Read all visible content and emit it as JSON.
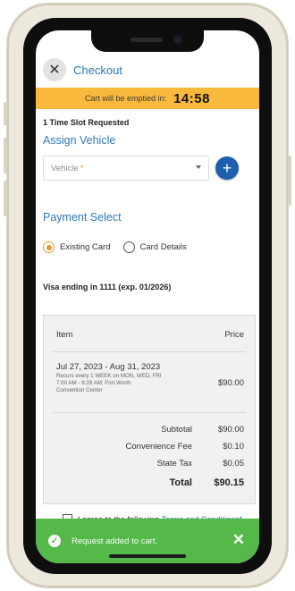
{
  "header": {
    "title": "Checkout"
  },
  "timer": {
    "label": "Cart will be emptied in:",
    "countdown": "14:58"
  },
  "booking": {
    "slots_text": "1 Time Slot Requested"
  },
  "vehicle": {
    "section_title": "Assign Vehicle",
    "placeholder": "Vehicle",
    "required_mark": "*",
    "add_label": "+"
  },
  "payment": {
    "section_title": "Payment Select",
    "options": [
      {
        "label": "Existing Card",
        "selected": true
      },
      {
        "label": "Card Details",
        "selected": false
      }
    ],
    "card_summary": "Visa ending in 1111 (exp. 01/2026)"
  },
  "order": {
    "headers": {
      "item": "Item",
      "price": "Price"
    },
    "line_item": {
      "dates": "Jul 27, 2023 - Aug 31, 2023",
      "desc_line1": "Recurs every 1 WEEK on MON, WED, FRI",
      "desc_line2": "7:00 AM - 9:29 AM; Fort Worth",
      "desc_line3": "Convention Center",
      "price": "$90.00"
    },
    "totals": [
      {
        "label": "Subtotal",
        "value": "$90.00"
      },
      {
        "label": "Convenience Fee",
        "value": "$0.10"
      },
      {
        "label": "State Tax",
        "value": "$0.05"
      },
      {
        "label": "Total",
        "value": "$90.15"
      }
    ]
  },
  "agreement": {
    "prefix": "I agree to the following",
    "link": "Terms and Conditions*"
  },
  "toast": {
    "message": "Request added to cart.",
    "close": "✕"
  },
  "colors": {
    "accent": "#2f78b7",
    "timer": "#f8b93c",
    "toast": "#54b948",
    "add_button": "#1d5fae"
  }
}
